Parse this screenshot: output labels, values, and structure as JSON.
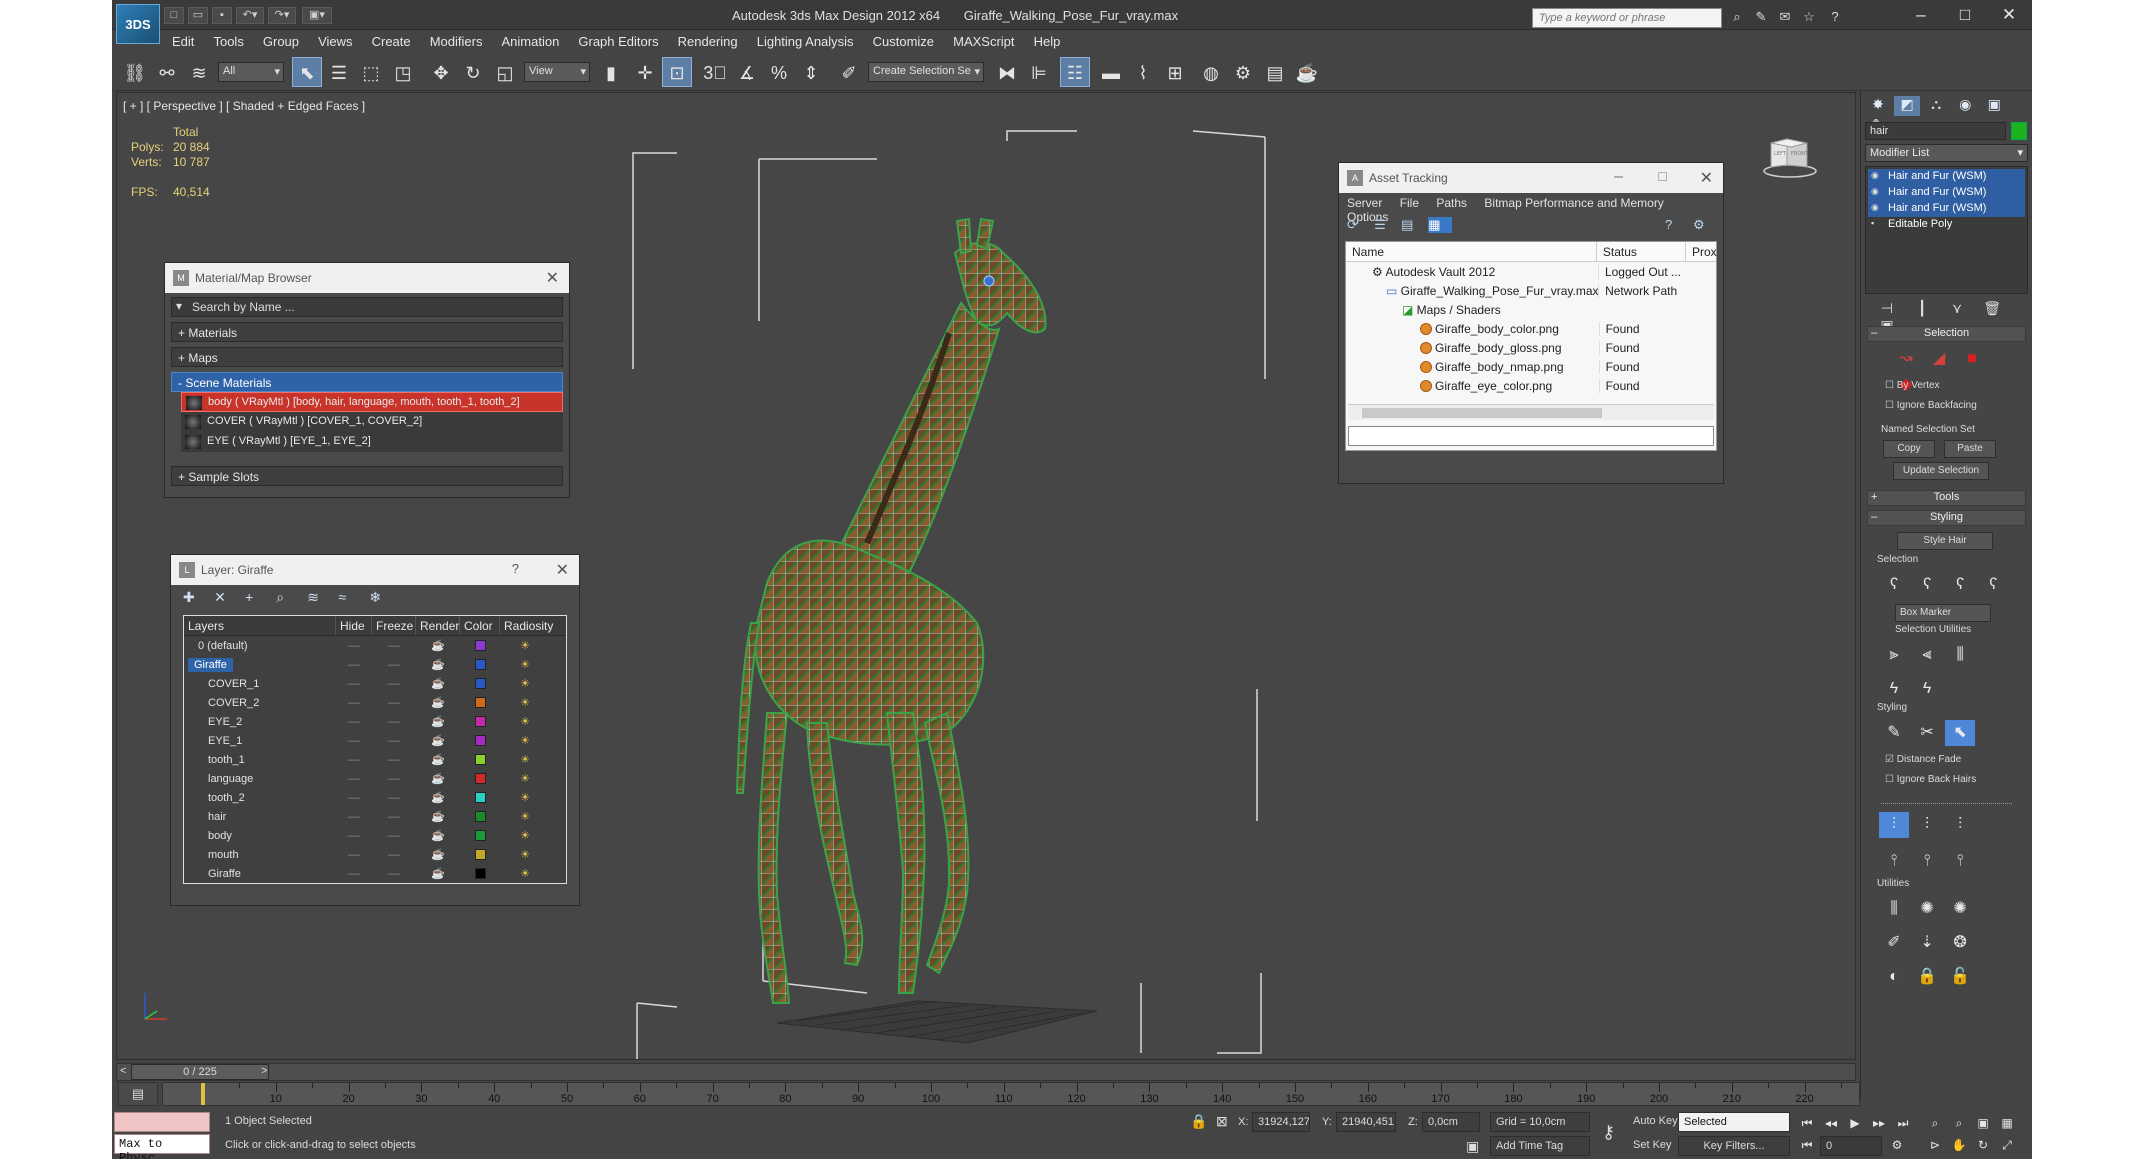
{
  "window": {
    "app_logo": "3DS",
    "title": "Autodesk 3ds Max Design 2012 x64",
    "filename": "Giraffe_Walking_Pose_Fur_vray.max",
    "search_placeholder": "Type a keyword or phrase",
    "controls": [
      "–",
      "□",
      "✕"
    ]
  },
  "menu": [
    "Edit",
    "Tools",
    "Group",
    "Views",
    "Create",
    "Modifiers",
    "Animation",
    "Graph Editors",
    "Rendering",
    "Lighting Analysis",
    "Customize",
    "MAXScript",
    "Help"
  ],
  "toolbar": {
    "filter": "All",
    "ref_coord": "View",
    "named_selection_placeholder": "Create Selection Se"
  },
  "viewport": {
    "label": "[ + ] [ Perspective ] [ Shaded + Edged Faces ]",
    "stats": {
      "header": "Total",
      "polys_label": "Polys:",
      "polys": "20 884",
      "verts_label": "Verts:",
      "verts": "10 787",
      "fps_label": "FPS:",
      "fps": "40,514"
    },
    "viewcube_faces": [
      "LEFT",
      "FRONT"
    ]
  },
  "material_browser": {
    "title": "Material/Map Browser",
    "search_placeholder": "Search by Name ...",
    "categories": [
      {
        "label": "+ Materials"
      },
      {
        "label": "+ Maps"
      },
      {
        "label": "- Scene Materials"
      }
    ],
    "materials": [
      {
        "label": "body  ( VRayMtl )  [body, hair, language, mouth, tooth_1, tooth_2]"
      },
      {
        "label": "COVER  ( VRayMtl )  [COVER_1, COVER_2]"
      },
      {
        "label": "EYE  ( VRayMtl )  [EYE_1, EYE_2]"
      }
    ],
    "sample_slots": "+ Sample Slots"
  },
  "layer_panel": {
    "title": "Layer: Giraffe",
    "help": "?",
    "columns": [
      "Layers",
      "Hide",
      "Freeze",
      "Render",
      "Color",
      "Radiosity"
    ],
    "rows": [
      {
        "name": "0 (default)",
        "color": "#8a3ad0"
      },
      {
        "name": "Giraffe",
        "color": "#2a59c7"
      },
      {
        "name": "COVER_1",
        "color": "#2a59c7"
      },
      {
        "name": "COVER_2",
        "color": "#d06a1a"
      },
      {
        "name": "EYE_2",
        "color": "#c42aa8"
      },
      {
        "name": "EYE_1",
        "color": "#a82ac4"
      },
      {
        "name": "tooth_1",
        "color": "#8ad02a"
      },
      {
        "name": "language",
        "color": "#d02a2a"
      },
      {
        "name": "tooth_2",
        "color": "#2ad0c4"
      },
      {
        "name": "hair",
        "color": "#1a8a2a"
      },
      {
        "name": "body",
        "color": "#1a9a3a"
      },
      {
        "name": "mouth",
        "color": "#c4a82a"
      },
      {
        "name": "Giraffe",
        "color": "#000000"
      }
    ]
  },
  "asset_tracking": {
    "title": "Asset Tracking",
    "menu": [
      "Server",
      "File",
      "Paths",
      "Bitmap Performance and Memory",
      "Options"
    ],
    "columns": [
      "Name",
      "Status",
      "Prox"
    ],
    "rows": [
      {
        "name": "Autodesk Vault 2012",
        "status": "Logged Out ..."
      },
      {
        "name": "Giraffe_Walking_Pose_Fur_vray.max",
        "status": "Network Path"
      },
      {
        "name": "Maps / Shaders",
        "status": ""
      },
      {
        "name": "Giraffe_body_color.png",
        "status": "Found"
      },
      {
        "name": "Giraffe_body_gloss.png",
        "status": "Found"
      },
      {
        "name": "Giraffe_body_nmap.png",
        "status": "Found"
      },
      {
        "name": "Giraffe_eye_color.png",
        "status": "Found"
      }
    ]
  },
  "command_panel": {
    "object_name": "hair",
    "modifier_list": "Modifier List",
    "stack": [
      {
        "label": "Hair and Fur (WSM)",
        "selected": true
      },
      {
        "label": "Hair and Fur (WSM)",
        "selected": true
      },
      {
        "label": "Hair and Fur (WSM)",
        "selected": true
      },
      {
        "label": "Editable Poly",
        "selected": false
      }
    ],
    "selection_rollout": "Selection",
    "by_vertex": "By Vertex",
    "ignore_backfacing": "Ignore Backfacing",
    "named_selection_set": "Named Selection Set",
    "copy": "Copy",
    "paste": "Paste",
    "update_selection": "Update Selection",
    "tools_rollout": "Tools",
    "styling_rollout": "Styling",
    "style_hair": "Style Hair",
    "selection_group": "Selection",
    "box_marker": "Box Marker",
    "selection_utilities": "Selection Utilities",
    "styling_group": "Styling",
    "distance_fade": "Distance Fade",
    "ignore_back_hairs": "Ignore Back Hairs",
    "utilities_group": "Utilities"
  },
  "timeline": {
    "frame": "0 / 225",
    "ticks": [
      10,
      20,
      30,
      40,
      50,
      60,
      70,
      80,
      90,
      100,
      110,
      120,
      130,
      140,
      150,
      160,
      170,
      180,
      190,
      200,
      210,
      220
    ]
  },
  "status": {
    "maxscript_line1": "",
    "maxscript_line2": "Max to Physc",
    "selection_info": "1 Object Selected",
    "prompt": "Click or click-and-drag to select objects",
    "x_label": "X:",
    "x": "31924,127",
    "y_label": "Y:",
    "y": "21940,451",
    "z_label": "Z:",
    "z": "0,0cm",
    "grid": "Grid = 10,0cm",
    "add_time_tag": "Add Time Tag",
    "auto_key": "Auto Key",
    "auto_key_mode": "Selected",
    "set_key": "Set Key",
    "key_filters": "Key Filters...",
    "current_frame": "0"
  }
}
